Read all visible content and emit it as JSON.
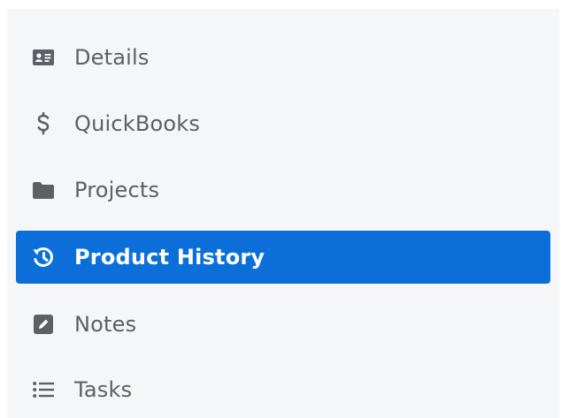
{
  "sidebar": {
    "items": [
      {
        "label": "Details",
        "icon": "id-card-icon",
        "active": false
      },
      {
        "label": "QuickBooks",
        "icon": "dollar-icon",
        "active": false
      },
      {
        "label": "Projects",
        "icon": "folder-icon",
        "active": false
      },
      {
        "label": "Product History",
        "icon": "history-icon",
        "active": true
      },
      {
        "label": "Notes",
        "icon": "note-edit-icon",
        "active": false
      },
      {
        "label": "Tasks",
        "icon": "list-icon",
        "active": false
      }
    ]
  },
  "colors": {
    "active_background": "#0a6fd8",
    "active_text": "#ffffff",
    "text": "#5b6067",
    "panel_background": "#f5f6f7"
  }
}
